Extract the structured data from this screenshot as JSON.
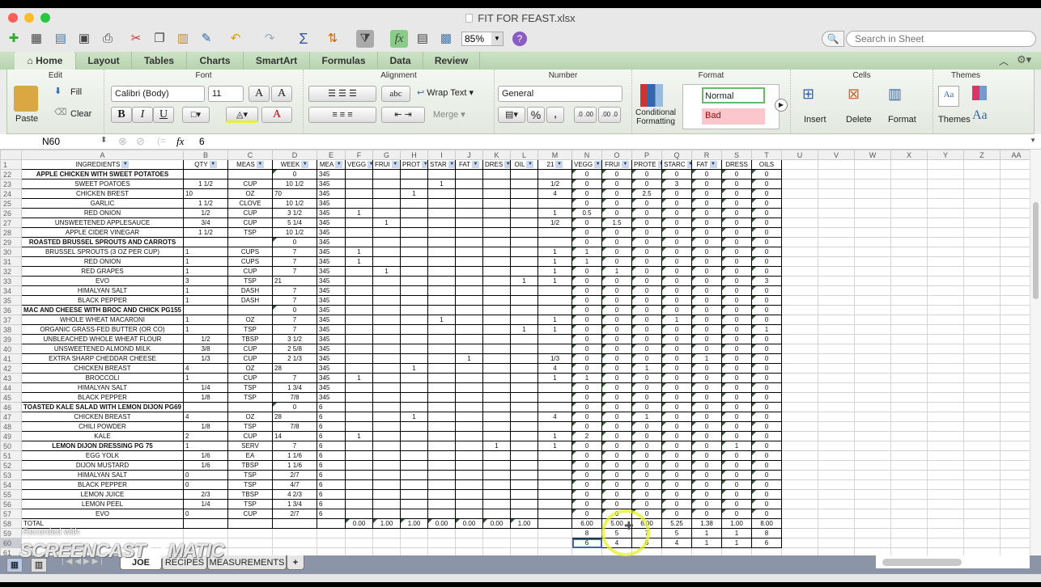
{
  "window": {
    "title": "FIT FOR FEAST.xlsx"
  },
  "toolbar": {
    "icons": [
      "new-icon",
      "templates-icon",
      "open-icon",
      "save-icon",
      "print-icon",
      "cut-icon",
      "copy-icon",
      "paste-icon",
      "format-painter-icon",
      "undo-icon",
      "redo-icon",
      "autosum-icon",
      "sort-icon",
      "filter-icon",
      "formula-builder-icon",
      "gallery-icon",
      "media-icon"
    ],
    "zoom": "85%",
    "search_placeholder": "Search in Sheet"
  },
  "ribbon_tabs": [
    "Home",
    "Layout",
    "Tables",
    "Charts",
    "SmartArt",
    "Formulas",
    "Data",
    "Review"
  ],
  "active_tab": "Home",
  "ribbon": {
    "edit": {
      "title": "Edit",
      "paste": "Paste",
      "fill": "Fill",
      "clear": "Clear"
    },
    "font": {
      "title": "Font",
      "family": "Calibri (Body)",
      "size": "11",
      "bold": "B",
      "italic": "I",
      "underline": "U",
      "grow": "A",
      "shrink": "A",
      "font_color": "A"
    },
    "alignment": {
      "title": "Alignment",
      "wrap": "Wrap Text",
      "merge": "Merge",
      "orientation": "abc"
    },
    "number": {
      "title": "Number",
      "format": "General",
      "percent": "%",
      "comma": ",",
      "inc_dec": ".0 .00",
      "dec_dec": ".00 .0"
    },
    "format": {
      "title": "Format",
      "conditional": "Conditional Formatting",
      "normal": "Normal",
      "bad": "Bad"
    },
    "cells": {
      "title": "Cells",
      "insert": "Insert",
      "delete": "Delete",
      "format": "Format"
    },
    "themes": {
      "title": "Themes",
      "themes": "Themes",
      "aa": "Aa"
    }
  },
  "formula_bar": {
    "name_box": "N60",
    "fx": "fx",
    "value": "6"
  },
  "columns": [
    "A",
    "B",
    "C",
    "D",
    "E",
    "F",
    "G",
    "H",
    "I",
    "J",
    "K",
    "L",
    "M",
    "N",
    "O",
    "P",
    "Q",
    "R",
    "S",
    "T",
    "U",
    "V",
    "W",
    "X",
    "Y",
    "Z",
    "AA"
  ],
  "header_row": {
    "num": "1",
    "cells": [
      "INGREDIENTS",
      "QTY",
      "MEAS",
      "WEEK",
      "MEA",
      "VEGG",
      "FRUI",
      "PROT",
      "STAR",
      "FAT",
      "DRES",
      "OIL",
      "21",
      "VEGG",
      "FRUI",
      "PROTE",
      "STARC",
      "FAT",
      "DRESS",
      "OILS"
    ]
  },
  "rows": [
    {
      "num": "22",
      "bold": true,
      "cells": [
        "APPLE CHICKEN WITH SWEET POTATOES",
        "",
        "",
        "0",
        "345",
        "",
        "",
        "",
        "",
        "",
        "",
        "",
        "",
        "0",
        "0",
        "0",
        "0",
        "0",
        "0",
        "0"
      ]
    },
    {
      "num": "23",
      "cells": [
        "SWEET POATOES",
        "1 1/2",
        "CUP",
        "10 1/2",
        "345",
        "",
        "",
        "",
        "1",
        "",
        "",
        "",
        "1/2",
        "0",
        "0",
        "0",
        "3",
        "0",
        "0",
        "0"
      ]
    },
    {
      "num": "24",
      "cells": [
        "CHICKEN BREST",
        "10",
        "OZ",
        "70",
        "345",
        "",
        "",
        "1",
        "",
        "",
        "",
        "",
        "4",
        "0",
        "0",
        "2.5",
        "0",
        "0",
        "0",
        "0"
      ]
    },
    {
      "num": "25",
      "cells": [
        "GARLIC",
        "1 1/2",
        "CLOVE",
        "10 1/2",
        "345",
        "",
        "",
        "",
        "",
        "",
        "",
        "",
        "",
        "0",
        "0",
        "0",
        "0",
        "0",
        "0",
        "0"
      ]
    },
    {
      "num": "26",
      "cells": [
        "RED ONION",
        "1/2",
        "CUP",
        "3 1/2",
        "345",
        "1",
        "",
        "",
        "",
        "",
        "",
        "",
        "1",
        "0.5",
        "0",
        "0",
        "0",
        "0",
        "0",
        "0"
      ]
    },
    {
      "num": "27",
      "cells": [
        "UNSWEETENED APPLESAUCE",
        "3/4",
        "CUP",
        "5 1/4",
        "345",
        "",
        "1",
        "",
        "",
        "",
        "",
        "",
        "1/2",
        "0",
        "1.5",
        "0",
        "0",
        "0",
        "0",
        "0"
      ]
    },
    {
      "num": "28",
      "cells": [
        "APPLE CIDER VINEGAR",
        "1 1/2",
        "TSP",
        "10 1/2",
        "345",
        "",
        "",
        "",
        "",
        "",
        "",
        "",
        "",
        "0",
        "0",
        "0",
        "0",
        "0",
        "0",
        "0"
      ]
    },
    {
      "num": "29",
      "bold": true,
      "cells": [
        "ROASTED BRUSSEL SPROUTS AND CARROTS",
        "",
        "",
        "0",
        "345",
        "",
        "",
        "",
        "",
        "",
        "",
        "",
        "",
        "0",
        "0",
        "0",
        "0",
        "0",
        "0",
        "0"
      ]
    },
    {
      "num": "30",
      "cells": [
        "BRUSSEL SPROUTS (3 OZ PER CUP)",
        "1",
        "CUPS",
        "7",
        "345",
        "1",
        "",
        "",
        "",
        "",
        "",
        "",
        "1",
        "1",
        "0",
        "0",
        "0",
        "0",
        "0",
        "0"
      ]
    },
    {
      "num": "31",
      "cells": [
        "RED ONION",
        "1",
        "CUPS",
        "7",
        "345",
        "1",
        "",
        "",
        "",
        "",
        "",
        "",
        "1",
        "1",
        "0",
        "0",
        "0",
        "0",
        "0",
        "0"
      ]
    },
    {
      "num": "32",
      "cells": [
        "RED GRAPES",
        "1",
        "CUP",
        "7",
        "345",
        "",
        "1",
        "",
        "",
        "",
        "",
        "",
        "1",
        "0",
        "1",
        "0",
        "0",
        "0",
        "0",
        "0"
      ]
    },
    {
      "num": "33",
      "cells": [
        "EVO",
        "3",
        "TSP",
        "21",
        "345",
        "",
        "",
        "",
        "",
        "",
        "",
        "1",
        "1",
        "0",
        "0",
        "0",
        "0",
        "0",
        "0",
        "3"
      ]
    },
    {
      "num": "34",
      "cells": [
        "HIMALYAN SALT",
        "1",
        "DASH",
        "7",
        "345",
        "",
        "",
        "",
        "",
        "",
        "",
        "",
        "",
        "0",
        "0",
        "0",
        "0",
        "0",
        "0",
        "0"
      ]
    },
    {
      "num": "35",
      "cells": [
        "BLACK PEPPER",
        "1",
        "DASH",
        "7",
        "345",
        "",
        "",
        "",
        "",
        "",
        "",
        "",
        "",
        "0",
        "0",
        "0",
        "0",
        "0",
        "0",
        "0"
      ]
    },
    {
      "num": "36",
      "bold": true,
      "cells": [
        "MAC AND CHEESE WITH BROC AND CHICK PG155",
        "",
        "",
        "0",
        "345",
        "",
        "",
        "",
        "",
        "",
        "",
        "",
        "",
        "0",
        "0",
        "0",
        "0",
        "0",
        "0",
        "0"
      ]
    },
    {
      "num": "37",
      "cells": [
        "WHOLE WHEAT MACARONI",
        "1",
        "OZ",
        "7",
        "345",
        "",
        "",
        "",
        "1",
        "",
        "",
        "",
        "1",
        "0",
        "0",
        "0",
        "1",
        "0",
        "0",
        "0"
      ]
    },
    {
      "num": "38",
      "cells": [
        "ORGANIC GRASS-FED BUTTER (OR CO)",
        "1",
        "TSP",
        "7",
        "345",
        "",
        "",
        "",
        "",
        "",
        "",
        "1",
        "1",
        "0",
        "0",
        "0",
        "0",
        "0",
        "0",
        "1"
      ]
    },
    {
      "num": "39",
      "cells": [
        "UNBLEACHED WHOLE WHEAT FLOUR",
        "1/2",
        "TBSP",
        "3 1/2",
        "345",
        "",
        "",
        "",
        "",
        "",
        "",
        "",
        "",
        "0",
        "0",
        "0",
        "0",
        "0",
        "0",
        "0"
      ]
    },
    {
      "num": "40",
      "cells": [
        "UNSWEETENED ALMOND MILK",
        "3/8",
        "CUP",
        "2 5/8",
        "345",
        "",
        "",
        "",
        "",
        "",
        "",
        "",
        "",
        "0",
        "0",
        "0",
        "0",
        "0",
        "0",
        "0"
      ]
    },
    {
      "num": "41",
      "cells": [
        "EXTRA SHARP CHEDDAR CHEESE",
        "1/3",
        "CUP",
        "2 1/3",
        "345",
        "",
        "",
        "",
        "",
        "1",
        "",
        "",
        "1/3",
        "0",
        "0",
        "0",
        "0",
        "1",
        "0",
        "0"
      ]
    },
    {
      "num": "42",
      "cells": [
        "CHICKEN BREAST",
        "4",
        "OZ",
        "28",
        "345",
        "",
        "",
        "1",
        "",
        "",
        "",
        "",
        "4",
        "0",
        "0",
        "1",
        "0",
        "0",
        "0",
        "0"
      ]
    },
    {
      "num": "43",
      "cells": [
        "BROCCOLI",
        "1",
        "CUP",
        "7",
        "345",
        "1",
        "",
        "",
        "",
        "",
        "",
        "",
        "1",
        "1",
        "0",
        "0",
        "0",
        "0",
        "0",
        "0"
      ]
    },
    {
      "num": "44",
      "cells": [
        "HIMALYAN SALT",
        "1/4",
        "TSP",
        "1 3/4",
        "345",
        "",
        "",
        "",
        "",
        "",
        "",
        "",
        "",
        "0",
        "0",
        "0",
        "0",
        "0",
        "0",
        "0"
      ]
    },
    {
      "num": "45",
      "cells": [
        "BLACK PEPPER",
        "1/8",
        "TSP",
        "7/8",
        "345",
        "",
        "",
        "",
        "",
        "",
        "",
        "",
        "",
        "0",
        "0",
        "0",
        "0",
        "0",
        "0",
        "0"
      ]
    },
    {
      "num": "46",
      "bold": true,
      "cells": [
        "TOASTED KALE SALAD WITH LEMON DIJON PG69",
        "",
        "",
        "0",
        "6",
        "",
        "",
        "",
        "",
        "",
        "",
        "",
        "",
        "0",
        "0",
        "0",
        "0",
        "0",
        "0",
        "0"
      ]
    },
    {
      "num": "47",
      "cells": [
        "CHICKEN BREAST",
        "4",
        "OZ",
        "28",
        "6",
        "",
        "",
        "1",
        "",
        "",
        "",
        "",
        "4",
        "0",
        "0",
        "1",
        "0",
        "0",
        "0",
        "0"
      ]
    },
    {
      "num": "48",
      "cells": [
        "CHILI POWDER",
        "1/8",
        "TSP",
        "7/8",
        "6",
        "",
        "",
        "",
        "",
        "",
        "",
        "",
        "",
        "0",
        "0",
        "0",
        "0",
        "0",
        "0",
        "0"
      ]
    },
    {
      "num": "49",
      "cells": [
        "KALE",
        "2",
        "CUP",
        "14",
        "6",
        "1",
        "",
        "",
        "",
        "",
        "",
        "",
        "1",
        "2",
        "0",
        "0",
        "0",
        "0",
        "0",
        "0"
      ]
    },
    {
      "num": "50",
      "bold": true,
      "cells": [
        "LEMON DIJON DRESSING PG 75",
        "1",
        "SERV",
        "7",
        "6",
        "",
        "",
        "",
        "",
        "",
        "1",
        "",
        "1",
        "0",
        "0",
        "0",
        "0",
        "0",
        "1",
        "0"
      ]
    },
    {
      "num": "51",
      "cells": [
        "EGG YOLK",
        "1/6",
        "EA",
        "1 1/6",
        "6",
        "",
        "",
        "",
        "",
        "",
        "",
        "",
        "",
        "0",
        "0",
        "0",
        "0",
        "0",
        "0",
        "0"
      ]
    },
    {
      "num": "52",
      "cells": [
        "DIJON MUSTARD",
        "1/6",
        "TBSP",
        "1 1/6",
        "6",
        "",
        "",
        "",
        "",
        "",
        "",
        "",
        "",
        "0",
        "0",
        "0",
        "0",
        "0",
        "0",
        "0"
      ]
    },
    {
      "num": "53",
      "cells": [
        "HIMALYAN SALT",
        "0",
        "TSP",
        "2/7",
        "6",
        "",
        "",
        "",
        "",
        "",
        "",
        "",
        "",
        "0",
        "0",
        "0",
        "0",
        "0",
        "0",
        "0"
      ]
    },
    {
      "num": "54",
      "cells": [
        "BLACK PEPPER",
        "0",
        "TSP",
        "4/7",
        "6",
        "",
        "",
        "",
        "",
        "",
        "",
        "",
        "",
        "0",
        "0",
        "0",
        "0",
        "0",
        "0",
        "0"
      ]
    },
    {
      "num": "55",
      "cells": [
        "LEMON JUICE",
        "2/3",
        "TBSP",
        "4 2/3",
        "6",
        "",
        "",
        "",
        "",
        "",
        "",
        "",
        "",
        "0",
        "0",
        "0",
        "0",
        "0",
        "0",
        "0"
      ]
    },
    {
      "num": "56",
      "cells": [
        "LEMON PEEL",
        "1/4",
        "TSP",
        "1 3/4",
        "6",
        "",
        "",
        "",
        "",
        "",
        "",
        "",
        "",
        "0",
        "0",
        "0",
        "0",
        "0",
        "0",
        "0"
      ]
    },
    {
      "num": "57",
      "cells": [
        "EVO",
        "0",
        "CUP",
        "2/7",
        "6",
        "",
        "",
        "",
        "",
        "",
        "",
        "",
        "",
        "0",
        "0",
        "0",
        "0",
        "0",
        "0",
        "0"
      ]
    },
    {
      "num": "58",
      "total": true,
      "cells": [
        "TOTAL",
        "",
        "",
        "",
        "",
        "0.00",
        "1.00",
        "1.00",
        "0.00",
        "0.00",
        "0.00",
        "1.00",
        "",
        "6.00",
        "5.00",
        "6.00",
        "5.25",
        "1.38",
        "1.00",
        "8.00"
      ]
    },
    {
      "num": "59",
      "cells": [
        "",
        "",
        "",
        "",
        "",
        "",
        "",
        "",
        "",
        "",
        "",
        "",
        "",
        "8",
        "5",
        "7",
        "5",
        "1",
        "1",
        "8"
      ]
    },
    {
      "num": "60",
      "cells": [
        "",
        "",
        "",
        "",
        "",
        "",
        "",
        "",
        "",
        "",
        "",
        "",
        "",
        "6",
        "4",
        "6",
        "4",
        "1",
        "1",
        "6"
      ]
    },
    {
      "num": "61",
      "cells": [
        "",
        "",
        "",
        "",
        "",
        "",
        "",
        "",
        "",
        "",
        "",
        "",
        "",
        "",
        "",
        "",
        "",
        "",
        "",
        ""
      ]
    }
  ],
  "selected_cell": "N60",
  "sheet_tabs": [
    "JOE",
    "RECIPES",
    "MEASUREMENTS",
    "+"
  ],
  "active_sheet": "JOE",
  "watermark": {
    "line1": "Recorded with",
    "line2": "SCREENCAST",
    "line3": "MATIC"
  }
}
